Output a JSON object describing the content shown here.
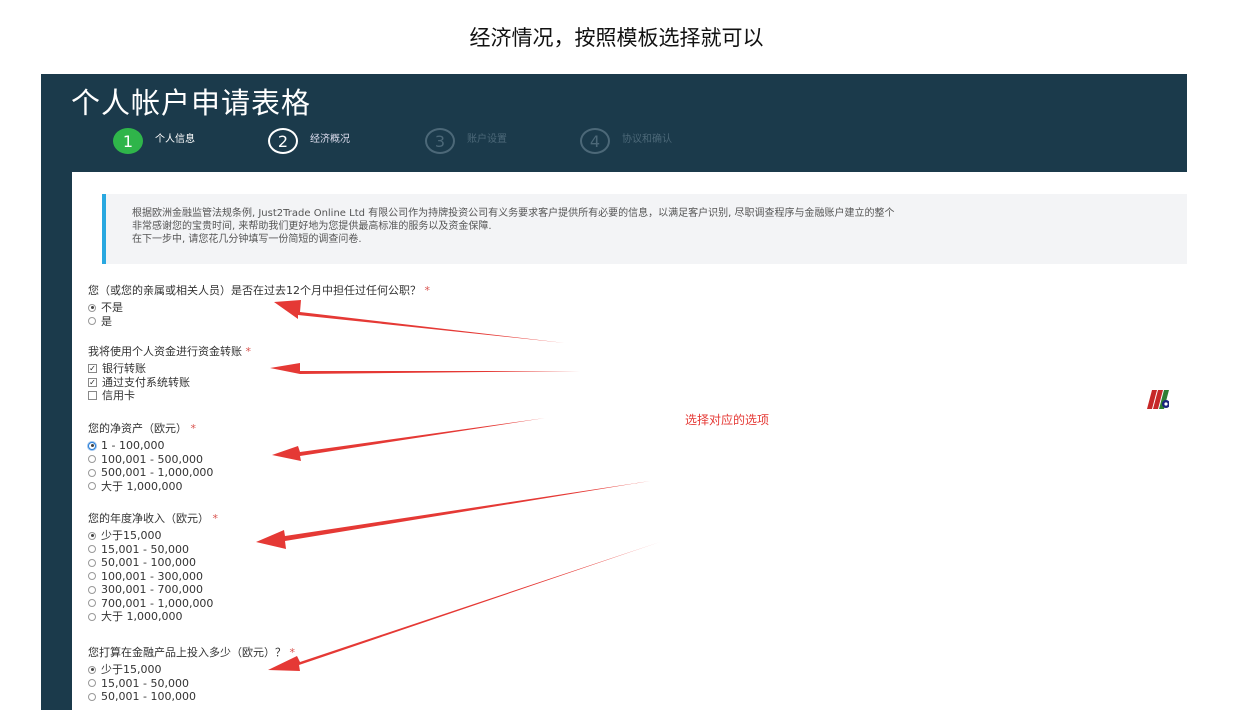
{
  "caption": "经济情况，按照模板选择就可以",
  "form": {
    "title": "个人帐户申请表格",
    "steps": [
      {
        "number": "1",
        "label": "个人信息"
      },
      {
        "number": "2",
        "label": "经济概况"
      },
      {
        "number": "3",
        "label": "账户设置"
      },
      {
        "number": "4",
        "label": "协议和确认"
      }
    ],
    "notice": [
      "根据欧洲金融监管法规条例, Just2Trade Online Ltd 有限公司作为持牌投资公司有义务要求客户提供所有必要的信息，以满足客户识别, 尽职调查程序与金融账户建立的整个",
      "非常感谢您的宝贵时间, 来帮助我们更好地为您提供最高标准的服务以及资金保障.",
      "在下一步中, 请您花几分钟填写一份简短的调查问卷."
    ],
    "questions": {
      "q1": {
        "label": "您（或您的亲属或相关人员）是否在过去12个月中担任过任何公职？",
        "required": "*",
        "options": [
          "不是",
          "是"
        ]
      },
      "q2": {
        "label": "我将使用个人资金进行资金转账",
        "required": "*",
        "options": [
          "银行转账",
          "通过支付系统转账",
          "信用卡"
        ]
      },
      "q3": {
        "label": "您的净资产（欧元）",
        "required": "*",
        "options": [
          "1 - 100,000",
          "100,001 - 500,000",
          "500,001 - 1,000,000",
          "大于 1,000,000"
        ]
      },
      "q4": {
        "label": "您的年度净收入（欧元）",
        "required": "*",
        "options": [
          "少于15,000",
          "15,001 - 50,000",
          "50,001 - 100,000",
          "100,001 - 300,000",
          "300,001 - 700,000",
          "700,001 - 1,000,000",
          "大于 1,000,000"
        ]
      },
      "q5": {
        "label": "您打算在金融产品上投入多少（欧元）？",
        "required": "*",
        "options": [
          "少于15,000",
          "15,001 - 50,000",
          "50,001 - 100,000"
        ]
      }
    }
  },
  "annotation": "选择对应的选项",
  "colors": {
    "header_bg": "#1b3a4b",
    "step_active": "#2fb54a",
    "accent": "#29a8e0",
    "arrow": "#e53935",
    "logo_red": "#c62828",
    "logo_green": "#2e7d32"
  }
}
